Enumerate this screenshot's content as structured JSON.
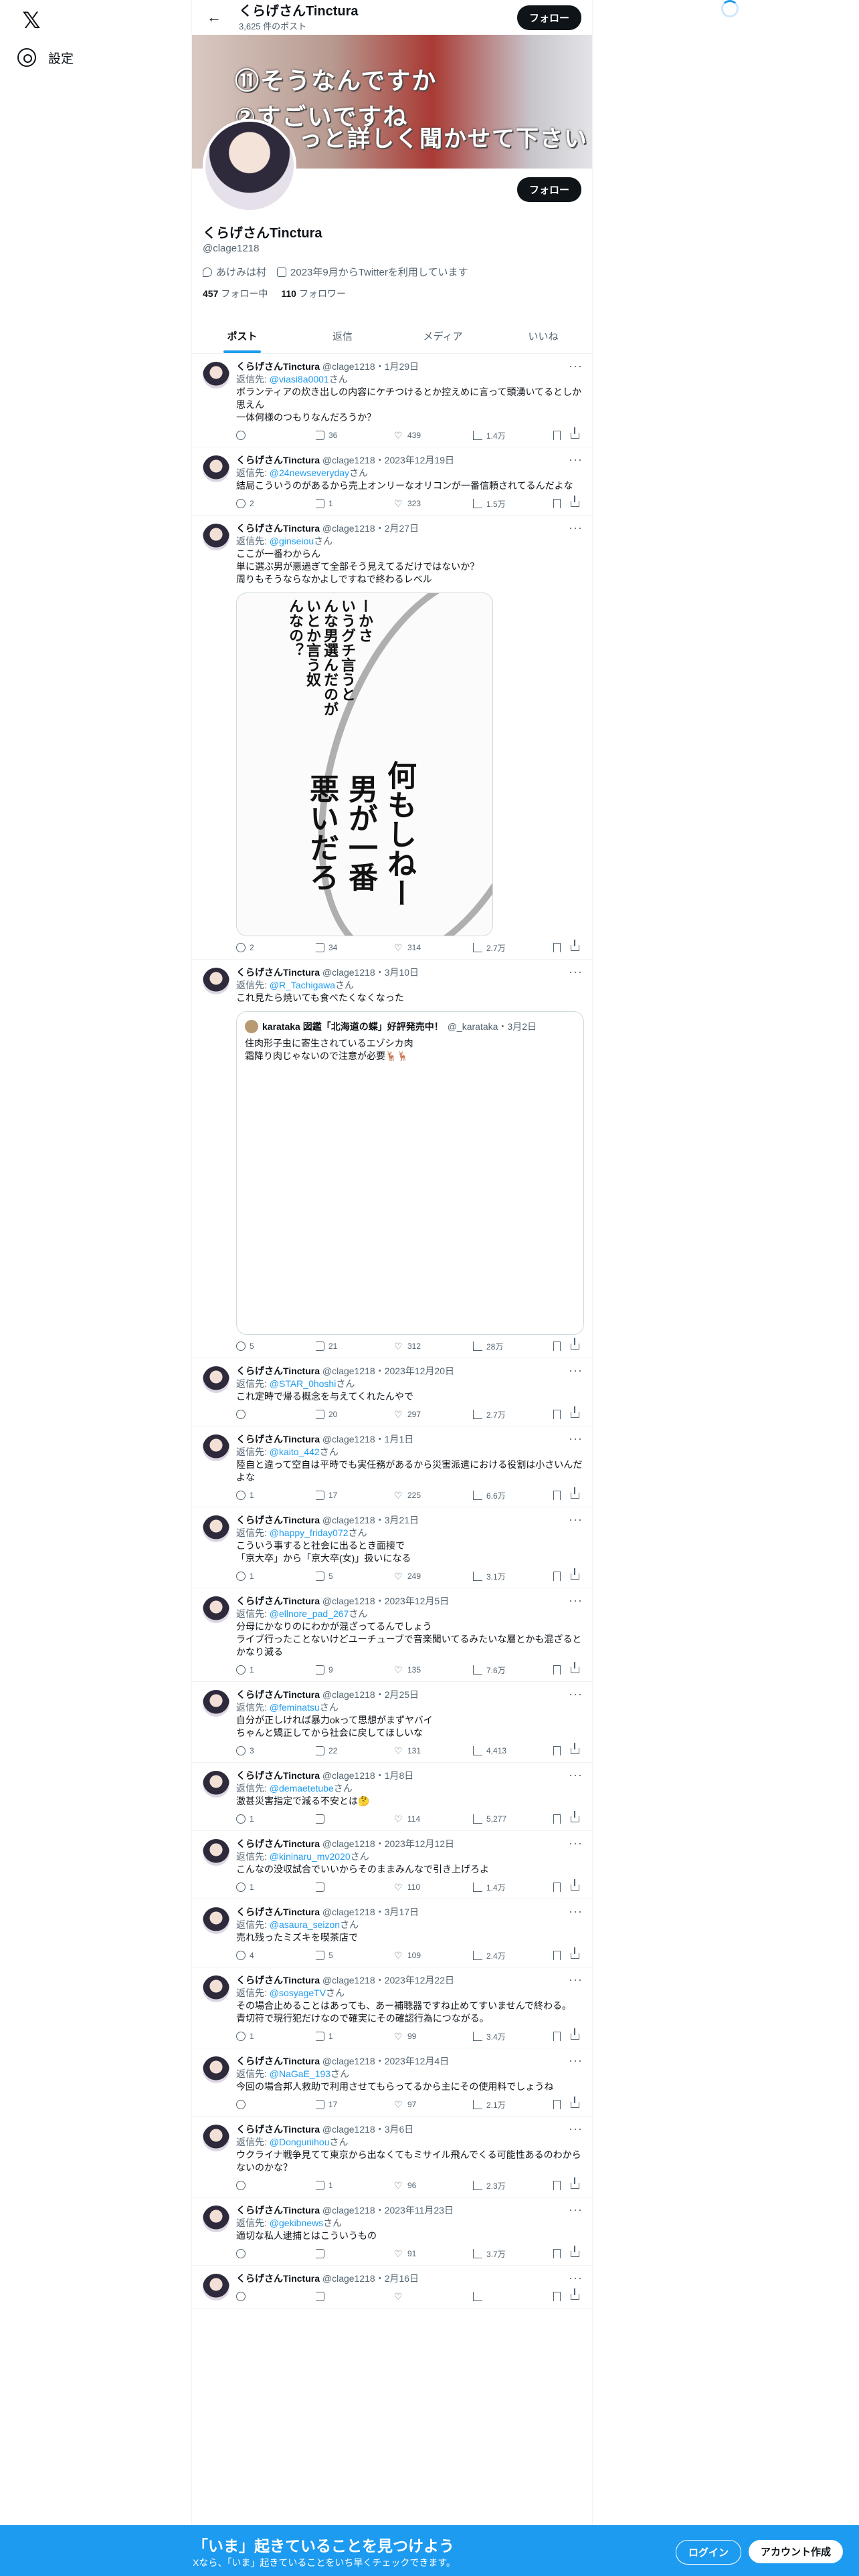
{
  "nav": {
    "x_logo": "𝕏",
    "settings_label": "設定"
  },
  "header": {
    "name": "くらげさんTinctura",
    "post_count": "3,625 件のポスト",
    "follow_label": "フォロー"
  },
  "banner": {
    "line1": "⑪そうなんですか",
    "line2": "②すごいですね",
    "line3": "っと詳しく聞かせて下さい"
  },
  "profile": {
    "name": "くらげさんTinctura",
    "handle": "@clage1218",
    "location": "あけみは村",
    "joined": "2023年9月からTwitterを利用しています",
    "following_count": "457",
    "following_label": "フォロー中",
    "followers_count": "110",
    "followers_label": "フォロワー",
    "follow_label": "フォロー"
  },
  "tabs": [
    "ポスト",
    "返信",
    "メディア",
    "いいね"
  ],
  "tweets": [
    {
      "name": "くらげさんTinctura",
      "meta": "@clage1218・1月29日",
      "reply_prefix": "返信先: ",
      "reply_to": "@viasi8a0001",
      "reply_suffix": "さん",
      "text": "ボランティアの炊き出しの内容にケチつけるとか控えめに言って頭湧いてるとしか思えん\n一体何様のつもりなんだろうか？",
      "replies": "",
      "retweets": "36",
      "likes": "439",
      "views": "1.4万"
    },
    {
      "name": "くらげさんTinctura",
      "meta": "@clage1218・2023年12月19日",
      "reply_prefix": "返信先: ",
      "reply_to": "@24newseveryday",
      "reply_suffix": "さん",
      "text": "結局こういうのがあるから売上オンリーなオリコンが一番信頼されてるんだよな",
      "replies": "2",
      "retweets": "1",
      "likes": "323",
      "views": "1.5万"
    },
    {
      "name": "くらげさんTinctura",
      "meta": "@clage1218・2月27日",
      "reply_prefix": "返信先: ",
      "reply_to": "@ginseiou",
      "reply_suffix": "さん",
      "text": "ここが一番わからん\n単に選ぶ男が悪過ぎて全部そう見えてるだけではないか？\n周りもそうならなかよしですねで終わるレベル",
      "replies": "2",
      "retweets": "34",
      "likes": "314",
      "views": "2.7万",
      "manga": {
        "col1": "ーかさ",
        "col2": "いうグチ言うと",
        "col3": "んな男選んだのが",
        "col4": "いとか言う奴",
        "col5": "んなの？",
        "big1": "何もしねー",
        "big2": "男が一番",
        "big3": "悪いだろ"
      }
    },
    {
      "name": "くらげさんTinctura",
      "meta": "@clage1218・3月10日",
      "reply_prefix": "返信先: ",
      "reply_to": "@R_Tachigawa",
      "reply_suffix": "さん",
      "text": "これ見たら焼いても食べたくなくなった",
      "replies": "5",
      "retweets": "21",
      "likes": "312",
      "views": "28万",
      "quote": {
        "name": "karataka 図鑑「北海道の蝶」好評発売中！",
        "meta": "@_karataka・3月2日",
        "text": "住肉形子虫に寄生されているエゾシカ肉\n霜降り肉じゃないので注意が必要🦌🦌"
      }
    },
    {
      "name": "くらげさんTinctura",
      "meta": "@clage1218・2023年12月20日",
      "reply_prefix": "返信先: ",
      "reply_to": "@STAR_0hoshi",
      "reply_suffix": "さん",
      "text": "これ定時で帰る概念を与えてくれたんやで",
      "replies": "",
      "retweets": "20",
      "likes": "297",
      "views": "2.7万"
    },
    {
      "name": "くらげさんTinctura",
      "meta": "@clage1218・1月1日",
      "reply_prefix": "返信先: ",
      "reply_to": "@kaito_442",
      "reply_suffix": "さん",
      "text": "陸自と違って空自は平時でも実任務があるから災害派遣における役割は小さいんだよな",
      "replies": "1",
      "retweets": "17",
      "likes": "225",
      "views": "6.6万"
    },
    {
      "name": "くらげさんTinctura",
      "meta": "@clage1218・3月21日",
      "reply_prefix": "返信先: ",
      "reply_to": "@happy_friday072",
      "reply_suffix": "さん",
      "text": "こういう事すると社会に出るとき面接で\n「京大卒」から「京大卒(女)」扱いになる",
      "replies": "1",
      "retweets": "5",
      "likes": "249",
      "views": "3.1万"
    },
    {
      "name": "くらげさんTinctura",
      "meta": "@clage1218・2023年12月5日",
      "reply_prefix": "返信先: ",
      "reply_to": "@ellnore_pad_267",
      "reply_suffix": "さん",
      "text": "分母にかなりのにわかが混ざってるんでしょう\nライブ行ったことないけどユーチューブで音楽聞いてるみたいな層とかも混ざるとかなり減る",
      "replies": "1",
      "retweets": "9",
      "likes": "135",
      "views": "7.6万"
    },
    {
      "name": "くらげさんTinctura",
      "meta": "@clage1218・2月25日",
      "reply_prefix": "返信先: ",
      "reply_to": "@feminatsu",
      "reply_suffix": "さん",
      "text": "自分が正しければ暴力okって思想がまずヤバイ\nちゃんと矯正してから社会に戻してほしいな",
      "replies": "3",
      "retweets": "22",
      "likes": "131",
      "views": "4,413"
    },
    {
      "name": "くらげさんTinctura",
      "meta": "@clage1218・1月8日",
      "reply_prefix": "返信先: ",
      "reply_to": "@demaetetube",
      "reply_suffix": "さん",
      "text": "激甚災害指定で減る不安とは🤔",
      "replies": "1",
      "retweets": "",
      "likes": "114",
      "views": "5,277"
    },
    {
      "name": "くらげさんTinctura",
      "meta": "@clage1218・2023年12月12日",
      "reply_prefix": "返信先: ",
      "reply_to": "@kininaru_mv2020",
      "reply_suffix": "さん",
      "text": "こんなの没収試合でいいからそのままみんなで引き上げろよ",
      "replies": "1",
      "retweets": "",
      "likes": "110",
      "views": "1.4万"
    },
    {
      "name": "くらげさんTinctura",
      "meta": "@clage1218・3月17日",
      "reply_prefix": "返信先: ",
      "reply_to": "@asaura_seizon",
      "reply_suffix": "さん",
      "text": "売れ残ったミズキを喫茶店で",
      "replies": "4",
      "retweets": "5",
      "likes": "109",
      "views": "2.4万"
    },
    {
      "name": "くらげさんTinctura",
      "meta": "@clage1218・2023年12月22日",
      "reply_prefix": "返信先: ",
      "reply_to": "@sosyageTV",
      "reply_suffix": "さん",
      "text": "その場合止めることはあっても、あー補聴器ですね止めてすいませんで終わる。\n青切符で現行犯だけなので確実にその確認行為につながる。",
      "replies": "1",
      "retweets": "1",
      "likes": "99",
      "views": "3.4万"
    },
    {
      "name": "くらげさんTinctura",
      "meta": "@clage1218・2023年12月4日",
      "reply_prefix": "返信先: ",
      "reply_to": "@NaGaE_193",
      "reply_suffix": "さん",
      "text": "今回の場合邦人救助で利用させてもらってるから主にその使用料でしょうね",
      "replies": "",
      "retweets": "17",
      "likes": "97",
      "views": "2.1万"
    },
    {
      "name": "くらげさんTinctura",
      "meta": "@clage1218・3月6日",
      "reply_prefix": "返信先: ",
      "reply_to": "@Donguriihou",
      "reply_suffix": "さん",
      "text": "ウクライナ戦争見てて東京から出なくてもミサイル飛んでくる可能性あるのわからないのかな？",
      "replies": "",
      "retweets": "1",
      "likes": "96",
      "views": "2.3万"
    },
    {
      "name": "くらげさんTinctura",
      "meta": "@clage1218・2023年11月23日",
      "reply_prefix": "返信先: ",
      "reply_to": "@gekibnews",
      "reply_suffix": "さん",
      "text": "適切な私人逮捕とはこういうもの",
      "replies": "",
      "retweets": "",
      "likes": "91",
      "views": "3.7万"
    },
    {
      "name": "くらげさんTinctura",
      "meta": "@clage1218・2月16日",
      "reply_prefix": "",
      "reply_to": "",
      "reply_suffix": "",
      "text": "",
      "replies": "",
      "retweets": "",
      "likes": "",
      "views": ""
    }
  ],
  "bottom_bar": {
    "title": "「いま」起きていることを見つけよう",
    "subtitle": "Xなら、「いま」起きていることをいち早くチェックできます。",
    "login_label": "ログイン",
    "signup_label": "アカウント作成"
  }
}
